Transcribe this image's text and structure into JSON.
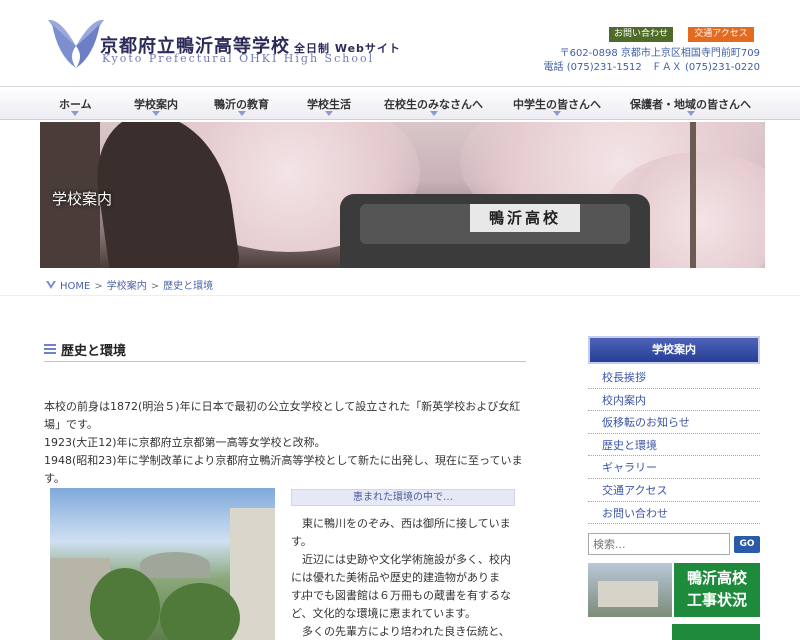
{
  "header": {
    "title": "京都府立鴨沂高等学校",
    "subtitle": "全日制 Webサイト",
    "title_en": "Kyoto Prefectural OHKI High School",
    "contact_label": "お問い合わせ",
    "access_label": "交通アクセス",
    "address": "〒602-0898 京都市上京区相国寺門前町709",
    "phone_fax": "電話 (075)231-1512　ＦＡＸ (075)231-0220"
  },
  "nav": [
    {
      "label": "ホーム"
    },
    {
      "label": "学校案内"
    },
    {
      "label": "鴨沂の教育"
    },
    {
      "label": "学校生活"
    },
    {
      "label": "在校生のみなさんへ"
    },
    {
      "label": "中学生の皆さんへ"
    },
    {
      "label": "保護者・地域の皆さんへ"
    }
  ],
  "hero": {
    "title": "学校案内",
    "bus_sign": "鴨沂高校"
  },
  "breadcrumb": {
    "home": "HOME",
    "sep": ">",
    "level1": "学校案内",
    "current": "歴史と環境"
  },
  "main": {
    "heading": "歴史と環境",
    "paragraphs": [
      "本校の前身は1872(明治５)年に日本で最初の公立女学校として設立された「新英学校および女紅場」です。",
      "1923(大正12)年に京都府立京都第一高等女学校と改称。",
      "1948(昭和23)年に学制改革により京都府立鴨沂高等学校として新たに出発し、現在に至っています。"
    ],
    "env_heading": "恵まれた環境の中で…",
    "env_paragraphs": [
      "　東に鴨川をのぞみ、西は御所に接しています。",
      "　近辺には史跡や文化学術施設が多く、校内には優れた美術品や歴史的建造物があります。",
      "　中でも図書館は６万冊もの蔵書を有するなど、文化的な環境に恵まれています。",
      "　多くの先輩方により培われた良き伝統と、そ"
    ]
  },
  "sidebar": {
    "title": "学校案内",
    "items": [
      {
        "label": "校長挨拶"
      },
      {
        "label": "校内案内"
      },
      {
        "label": "仮移転のお知らせ"
      },
      {
        "label": "歴史と環境"
      },
      {
        "label": "ギャラリー"
      },
      {
        "label": "交通アクセス"
      },
      {
        "label": "お問い合わせ"
      }
    ],
    "search_placeholder": "検索...",
    "search_button": "GO",
    "banner_text_1": "鴨沂高校",
    "banner_text_2": "工事状況"
  },
  "colors": {
    "brand": "#2b2b5a",
    "link": "#3d55a8",
    "contact_btn": "#4f6b2a",
    "access_btn": "#e46a1f",
    "banner_green": "#1e8a3c"
  }
}
